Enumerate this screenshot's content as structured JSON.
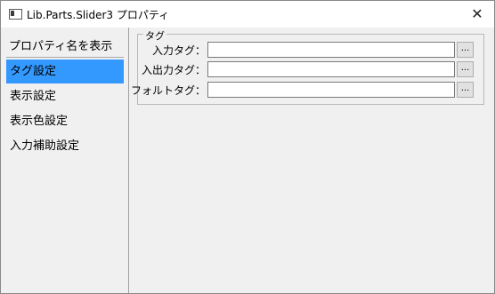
{
  "window": {
    "title": "Lib.Parts.Slider3 プロパティ",
    "close_glyph": "✕"
  },
  "sidebar": {
    "toggle_label": "プロパティ名を表示",
    "items": [
      {
        "label": "タグ設定",
        "selected": true
      },
      {
        "label": "表示設定",
        "selected": false
      },
      {
        "label": "表示色設定",
        "selected": false
      },
      {
        "label": "入力補助設定",
        "selected": false
      }
    ]
  },
  "tag_group": {
    "legend": "タグ",
    "fields": [
      {
        "label": "入力タグ：",
        "value": "",
        "browse_label": "..."
      },
      {
        "label": "入出力タグ：",
        "value": "",
        "browse_label": "..."
      },
      {
        "label": "フォルトタグ：",
        "value": "",
        "browse_label": "..."
      }
    ]
  },
  "colors": {
    "selection": "#3399ff",
    "window_bg": "#f0f0f0"
  }
}
